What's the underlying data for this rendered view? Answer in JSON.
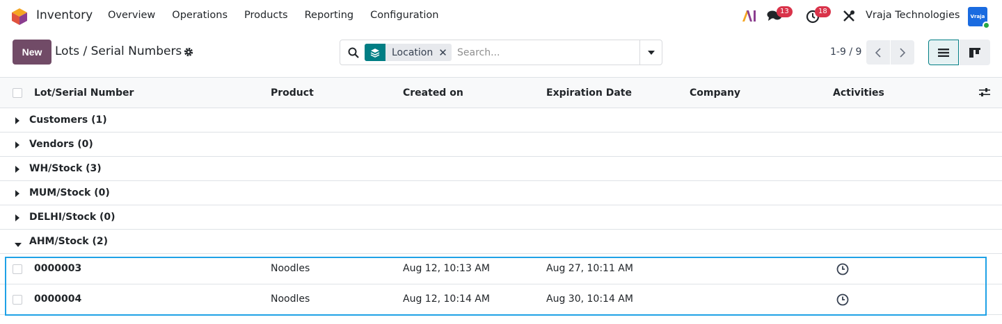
{
  "navbar": {
    "app_name": "Inventory",
    "menu": [
      "Overview",
      "Operations",
      "Products",
      "Reporting",
      "Configuration"
    ],
    "ai_label": "AI",
    "messages_count": "13",
    "activities_count": "18",
    "company": "Vraja Technologies",
    "avatar_text": "Vraja"
  },
  "control_panel": {
    "new_label": "New",
    "title": "Lots / Serial Numbers",
    "facet_label": "Location",
    "search_placeholder": "Search...",
    "pager": "1-9 / 9"
  },
  "columns": [
    "Lot/Serial Number",
    "Product",
    "Created on",
    "Expiration Date",
    "Company",
    "Activities"
  ],
  "groups": [
    {
      "label": "Customers (1)",
      "expanded": false
    },
    {
      "label": "Vendors (0)",
      "expanded": false
    },
    {
      "label": "WH/Stock (3)",
      "expanded": false
    },
    {
      "label": "MUM/Stock (0)",
      "expanded": false
    },
    {
      "label": "DELHI/Stock (0)",
      "expanded": false
    },
    {
      "label": "AHM/Stock (2)",
      "expanded": true
    }
  ],
  "rows": [
    {
      "lot": "0000003",
      "product": "Noodles",
      "created": "Aug 12, 10:13 AM",
      "expiration": "Aug 27, 10:11 AM",
      "company": ""
    },
    {
      "lot": "0000004",
      "product": "Noodles",
      "created": "Aug 12, 10:14 AM",
      "expiration": "Aug 30, 10:14 AM",
      "company": ""
    }
  ],
  "colors": {
    "brand": "#714b67",
    "accent": "#017e84",
    "badge": "#d9334a",
    "highlight": "#1ea1e6"
  }
}
